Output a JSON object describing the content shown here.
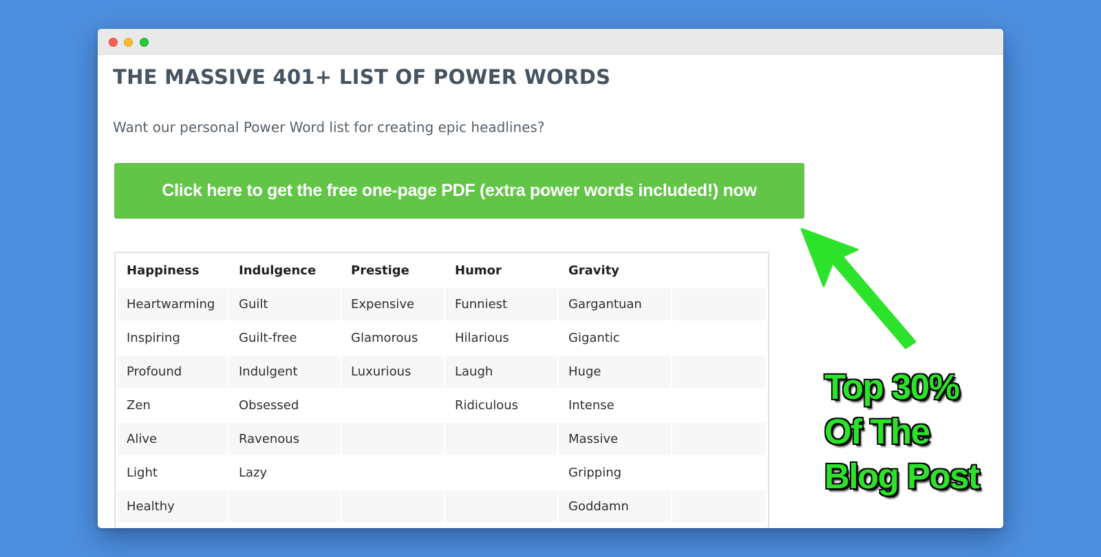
{
  "colors": {
    "background": "#4d8fdf",
    "cta": "#63c548",
    "annotation": "#2de22b",
    "arrow": "#2de22b"
  },
  "window": {
    "controls": [
      "close",
      "minimize",
      "zoom"
    ]
  },
  "page": {
    "headline": "THE MASSIVE 401+ LIST OF POWER WORDS",
    "subtitle": "Want our personal Power Word list for creating epic headlines?",
    "cta_label": "Click here to get the free one-page PDF (extra power words included!) now"
  },
  "table": {
    "headers": [
      "Happiness",
      "Indulgence",
      "Prestige",
      "Humor",
      "Gravity",
      ""
    ],
    "rows": [
      [
        "Heartwarming",
        "Guilt",
        "Expensive",
        "Funniest",
        "Gargantuan",
        ""
      ],
      [
        "Inspiring",
        "Guilt-free",
        "Glamorous",
        "Hilarious",
        "Gigantic",
        ""
      ],
      [
        "Profound",
        "Indulgent",
        "Luxurious",
        "Laugh",
        "Huge",
        ""
      ],
      [
        "Zen",
        "Obsessed",
        "",
        "Ridiculous",
        "Intense",
        ""
      ],
      [
        "Alive",
        "Ravenous",
        "",
        "",
        "Massive",
        ""
      ],
      [
        "Light",
        "Lazy",
        "",
        "",
        "Gripping",
        ""
      ],
      [
        "Healthy",
        "",
        "",
        "",
        "Goddamn",
        ""
      ]
    ]
  },
  "annotation": {
    "lines": [
      "Top 30%",
      "Of The",
      "Blog Post"
    ],
    "arrow_icon": "arrow-up-left-icon"
  }
}
